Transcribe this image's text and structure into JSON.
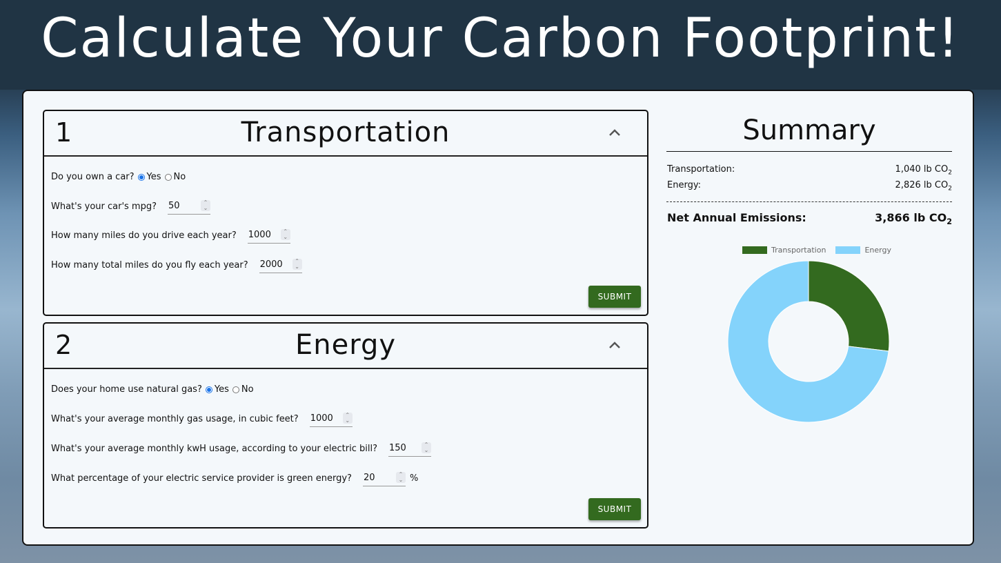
{
  "page": {
    "title": "Calculate Your Carbon Footprint!"
  },
  "transportation": {
    "number": "1",
    "title": "Transportation",
    "own_car_q": "Do you own a car?",
    "yes": "Yes",
    "no": "No",
    "own_car_selected": "Yes",
    "mpg_q": "What's your car's mpg?",
    "mpg_value": "50",
    "miles_q": "How many miles do you drive each year?",
    "miles_value": "1000",
    "fly_q": "How many total miles do you fly each year?",
    "fly_value": "2000",
    "submit": "SUBMIT"
  },
  "energy": {
    "number": "2",
    "title": "Energy",
    "gas_q": "Does your home use natural gas?",
    "yes": "Yes",
    "no": "No",
    "gas_selected": "Yes",
    "gas_usage_q": "What's your average monthly gas usage, in cubic feet?",
    "gas_usage_value": "1000",
    "kwh_q": "What's your average monthly kwH usage, according to your electric bill?",
    "kwh_value": "150",
    "green_q": "What percentage of your electric service provider is green energy?",
    "green_value": "20",
    "green_unit": "%",
    "submit": "SUBMIT"
  },
  "summary": {
    "title": "Summary",
    "transport_label": "Transportation:",
    "transport_amount": "1,040 lb CO",
    "energy_label": "Energy:",
    "energy_amount": "2,826 lb CO",
    "co2_sub": "2",
    "net_label": "Net Annual Emissions:",
    "net_amount": "3,866 lb CO"
  },
  "colors": {
    "transportation": "#336a1f",
    "energy": "#84d3fb",
    "button": "#336a1f"
  },
  "icons": {
    "collapse": "chevron-up-icon"
  },
  "chart_data": {
    "type": "pie",
    "variant": "doughnut",
    "categories": [
      "Transportation",
      "Energy"
    ],
    "values": [
      1040,
      2826
    ],
    "legend": "top",
    "colors": [
      "#336a1f",
      "#84d3fb"
    ]
  }
}
